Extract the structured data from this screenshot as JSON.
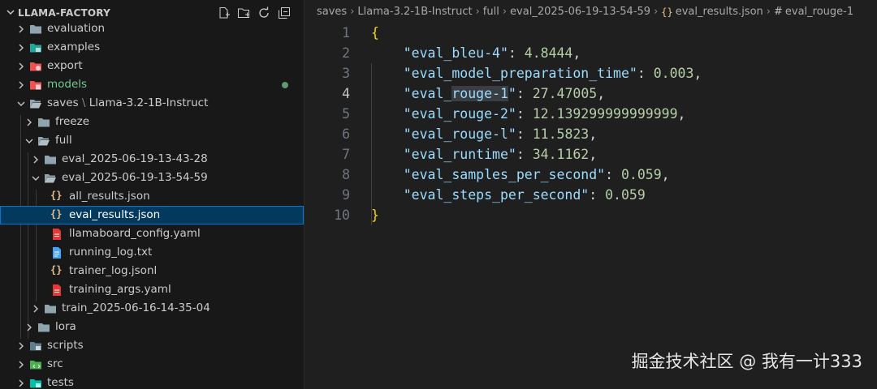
{
  "explorer": {
    "root": "LLAMA-FACTORY",
    "toolbar": [
      "new-file-icon",
      "new-folder-icon",
      "refresh-icon",
      "collapse-all-icon"
    ],
    "items": [
      {
        "label": "evaluation",
        "icon": "folder",
        "expanded": false
      },
      {
        "label": "examples",
        "icon": "folder-examples",
        "expanded": false
      },
      {
        "label": "export",
        "icon": "folder-export",
        "expanded": false
      },
      {
        "label": "models",
        "icon": "folder-models",
        "expanded": false,
        "modified": true
      },
      {
        "label_prefix": "saves",
        "label_suffix": "Llama-3.2-1B-Instruct",
        "icon": "folder-open",
        "expanded": true
      },
      {
        "label": "freeze",
        "icon": "folder",
        "expanded": false
      },
      {
        "label": "full",
        "icon": "folder-open",
        "expanded": true
      },
      {
        "label": "eval_2025-06-19-13-43-28",
        "icon": "folder",
        "expanded": false
      },
      {
        "label": "eval_2025-06-19-13-54-59",
        "icon": "folder-open",
        "expanded": true
      },
      {
        "label": "all_results.json",
        "icon": "json"
      },
      {
        "label": "eval_results.json",
        "icon": "json",
        "selected": true
      },
      {
        "label": "llamaboard_config.yaml",
        "icon": "yaml"
      },
      {
        "label": "running_log.txt",
        "icon": "txt"
      },
      {
        "label": "trainer_log.jsonl",
        "icon": "json"
      },
      {
        "label": "training_args.yaml",
        "icon": "yaml"
      },
      {
        "label": "train_2025-06-16-14-35-04",
        "icon": "folder",
        "expanded": false
      },
      {
        "label": "lora",
        "icon": "folder",
        "expanded": false
      },
      {
        "label": "scripts",
        "icon": "folder-scripts",
        "expanded": false
      },
      {
        "label": "src",
        "icon": "folder-src",
        "expanded": false
      },
      {
        "label": "tests",
        "icon": "folder-tests",
        "expanded": false
      }
    ]
  },
  "editor": {
    "breadcrumb": [
      "saves",
      "Llama-3.2-1B-Instruct",
      "full",
      "eval_2025-06-19-13-54-59",
      "eval_results.json",
      "eval_rouge-1"
    ],
    "active_line": 4,
    "line_numbers": [
      "1",
      "2",
      "3",
      "4",
      "5",
      "6",
      "7",
      "8",
      "9",
      "10"
    ],
    "entries": [
      {
        "key": "\"eval_bleu-4\"",
        "value": "4.8444"
      },
      {
        "key": "\"eval_model_preparation_time\"",
        "value": "0.003"
      },
      {
        "key_pre": "\"eval_",
        "key_hl": "rouge-1",
        "key_post": "\"",
        "value": "27.47005"
      },
      {
        "key": "\"eval_rouge-2\"",
        "value": "12.139299999999999"
      },
      {
        "key": "\"eval_rouge-l\"",
        "value": "11.5823"
      },
      {
        "key": "\"eval_runtime\"",
        "value": "34.1162"
      },
      {
        "key": "\"eval_samples_per_second\"",
        "value": "0.059"
      },
      {
        "key": "\"eval_steps_per_second\"",
        "value": "0.059"
      }
    ],
    "open_brace": "{",
    "close_brace": "}"
  },
  "watermark": "掘金技术社区 @ 我有一计333",
  "colors": {
    "selection_bg": "#04395e",
    "json_key": "#9cdcfe",
    "json_number": "#b5cea8",
    "brace": "#ffd700",
    "modified_dot": "#5e9a6a"
  }
}
